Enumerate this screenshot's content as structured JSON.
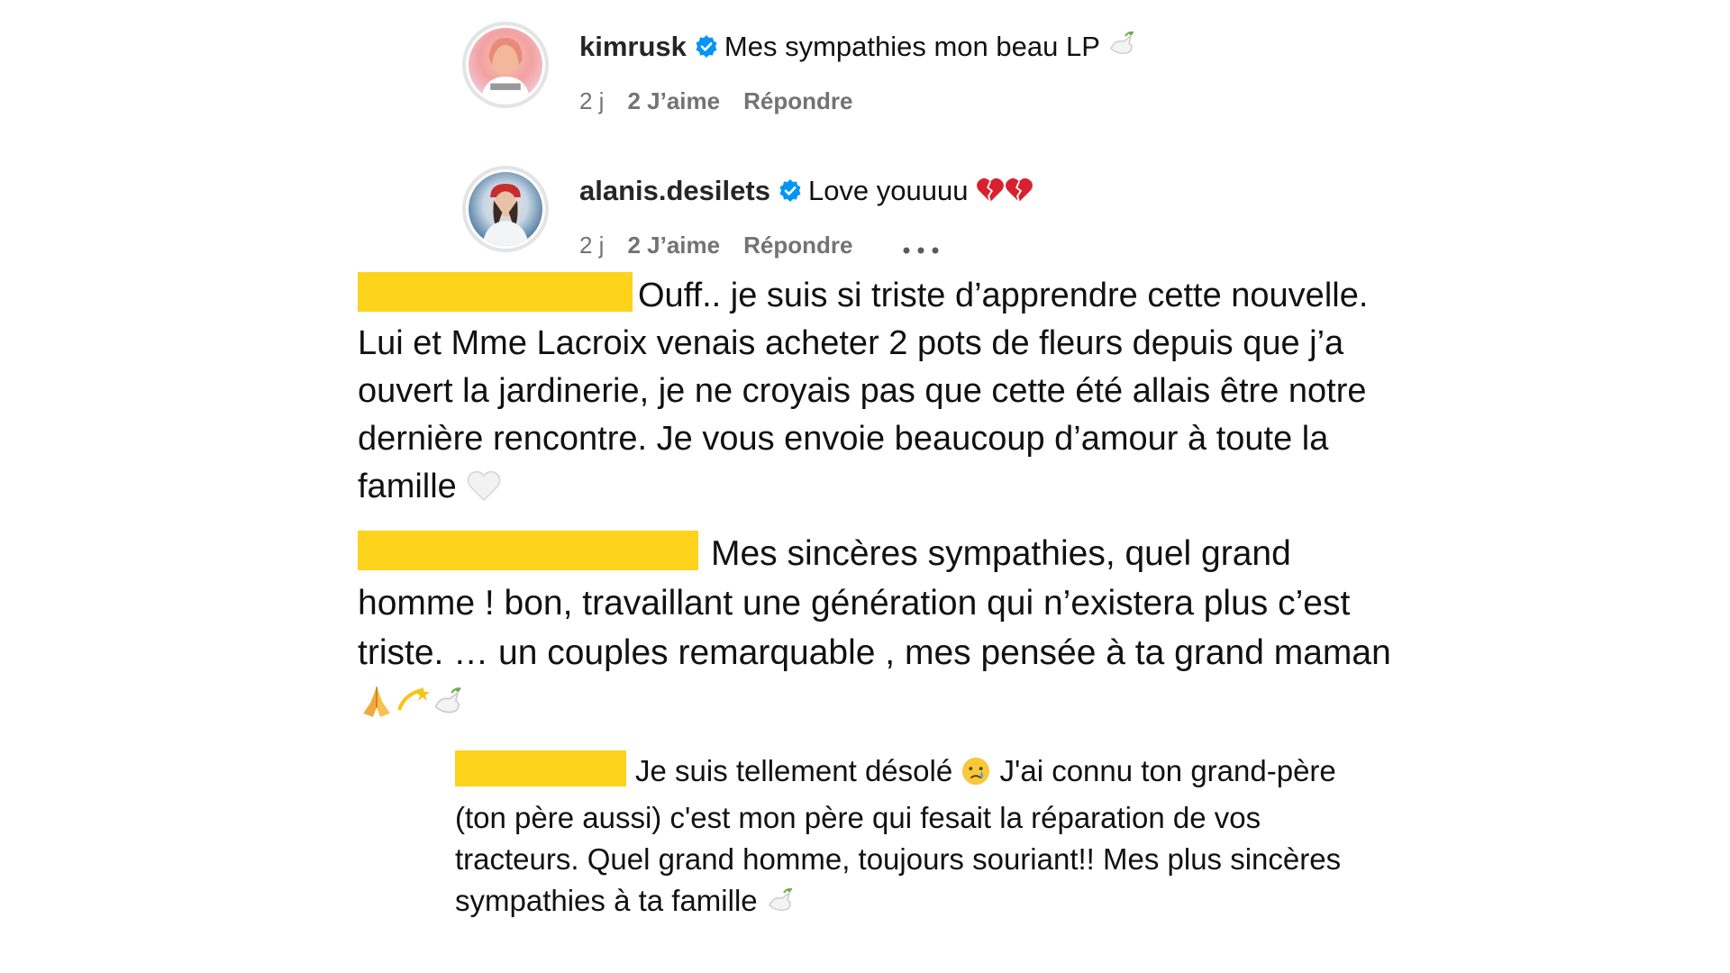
{
  "comments": [
    {
      "username": "kimrusk",
      "verified": true,
      "text": "Mes sympathies mon beau LP",
      "emojis": [
        "dove-icon"
      ],
      "time": "2 j",
      "likes": "2 J’aime",
      "reply_label": "Répondre"
    },
    {
      "username": "alanis.desilets",
      "verified": true,
      "text": "Love youuuu",
      "emojis": [
        "broken-heart-icon",
        "broken-heart-icon"
      ],
      "time": "2 j",
      "likes": "2 J’aime",
      "reply_label": "Répondre",
      "more_icon": "more-options-icon"
    }
  ],
  "plain_comments": [
    {
      "text": "Ouff.. je suis si triste d’apprendre cette nouvelle. Lui et Mme Lacroix venais acheter 2 pots de fleurs depuis que j’a ouvert la jardinerie, je ne croyais pas que cette été allais être notre dernière rencontre. Je vous envoie beaucoup d’amour à toute la famille",
      "emojis": [
        "white-heart-icon"
      ]
    },
    {
      "text": "Mes sincères sympathies, quel grand homme ! bon, travaillant une génération qui n’existera plus c’est triste. … un couples remarquable , mes pensée à ta grand maman",
      "emojis": [
        "folded-hands-icon",
        "dizzy-star-icon",
        "dove-icon"
      ]
    },
    {
      "text_before_emoji": "Je suis tellement désolé",
      "emoji_middle": "crying-face-icon",
      "text_after_emoji": "J'ai connu ton grand-père (ton père aussi) c'est mon père qui fesait la réparation de vos tracteurs. Quel grand homme, toujours souriant!! Mes plus sincères sympathies à ta famille",
      "emojis": [
        "dove-icon"
      ]
    }
  ],
  "colors": {
    "redaction": "#fdd31c",
    "verified_badge": "#0095f6",
    "meta_text": "#737373",
    "text": "#111111"
  }
}
